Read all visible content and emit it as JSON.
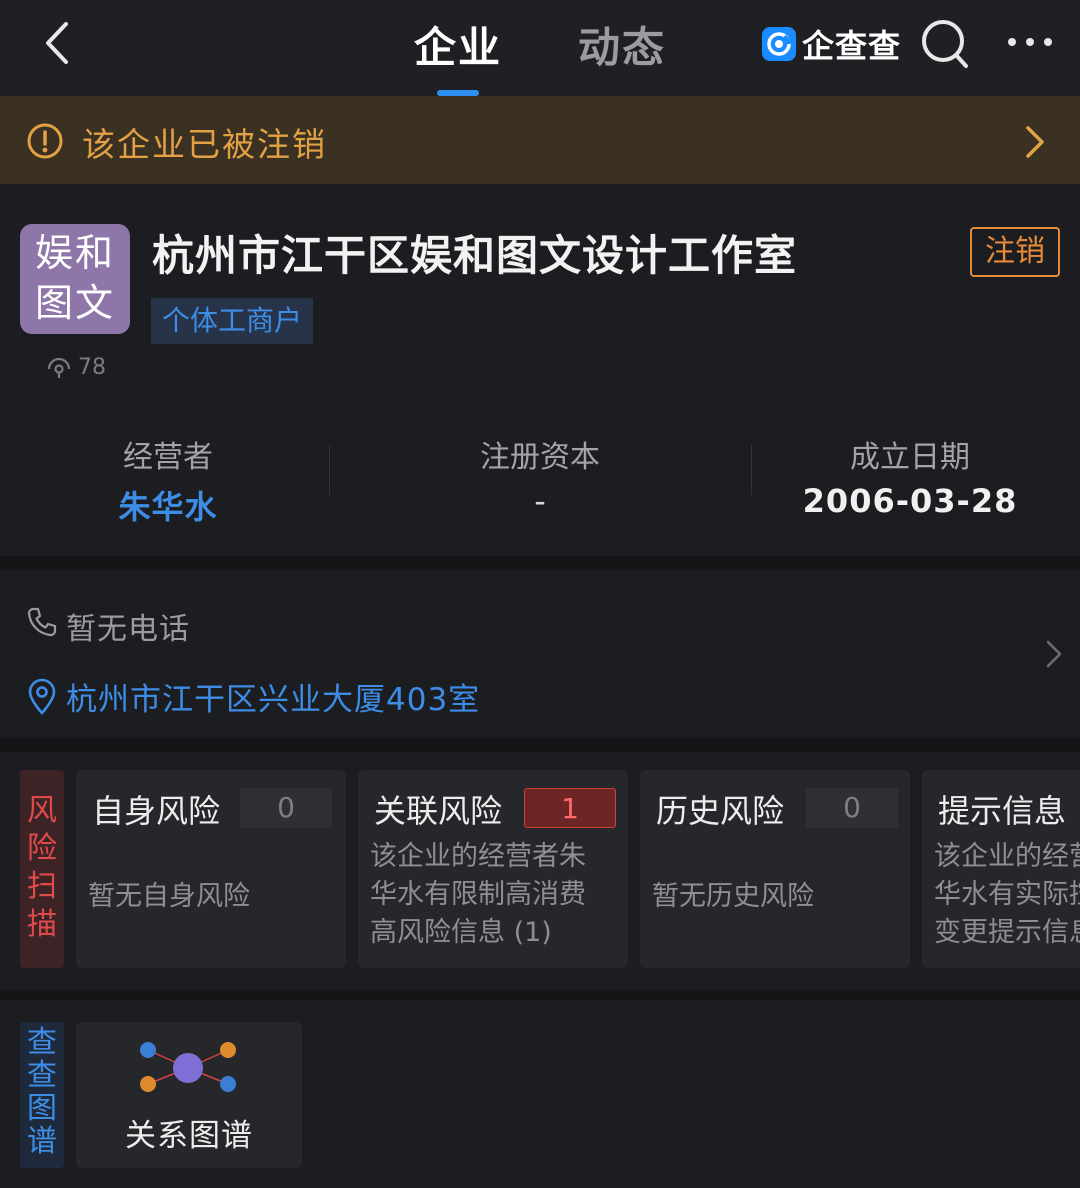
{
  "nav": {
    "tabs": [
      {
        "label": "企业",
        "active": true
      },
      {
        "label": "动态",
        "active": false
      }
    ],
    "brand": "企查查",
    "accent_color": "#2f8ff0",
    "icons": [
      "back-arrow-icon",
      "search-icon",
      "more-dots-icon"
    ]
  },
  "banner": {
    "text": "该企业已被注销",
    "color": "#e3a143"
  },
  "company": {
    "logo_text": [
      "娱和",
      "图文"
    ],
    "name": "杭州市江干区娱和图文设计工作室",
    "status": "注销",
    "type": "个体工商户",
    "views": "78"
  },
  "stats": [
    {
      "label": "经营者",
      "value": "朱华水"
    },
    {
      "label": "注册资本",
      "value": "-"
    },
    {
      "label": "成立日期",
      "value": "2006-03-28"
    }
  ],
  "contact": {
    "phone": "暂无电话",
    "address": "杭州市江干区兴业大厦403室"
  },
  "risk": {
    "tag": "风险扫描",
    "cards": [
      {
        "title": "自身风险",
        "count": "0",
        "desc": "暂无自身风险"
      },
      {
        "title": "关联风险",
        "count": "1",
        "desc": "该企业的经营者朱华水有限制高消费高风险信息 (1)"
      },
      {
        "title": "历史风险",
        "count": "0",
        "desc": "暂无历史风险"
      },
      {
        "title": "提示信息",
        "count": "",
        "desc": "该企业的经营者朱华水有实际控制人变更提示信息"
      }
    ]
  },
  "graph": {
    "tag": "查查图谱",
    "label": "关系图谱"
  }
}
